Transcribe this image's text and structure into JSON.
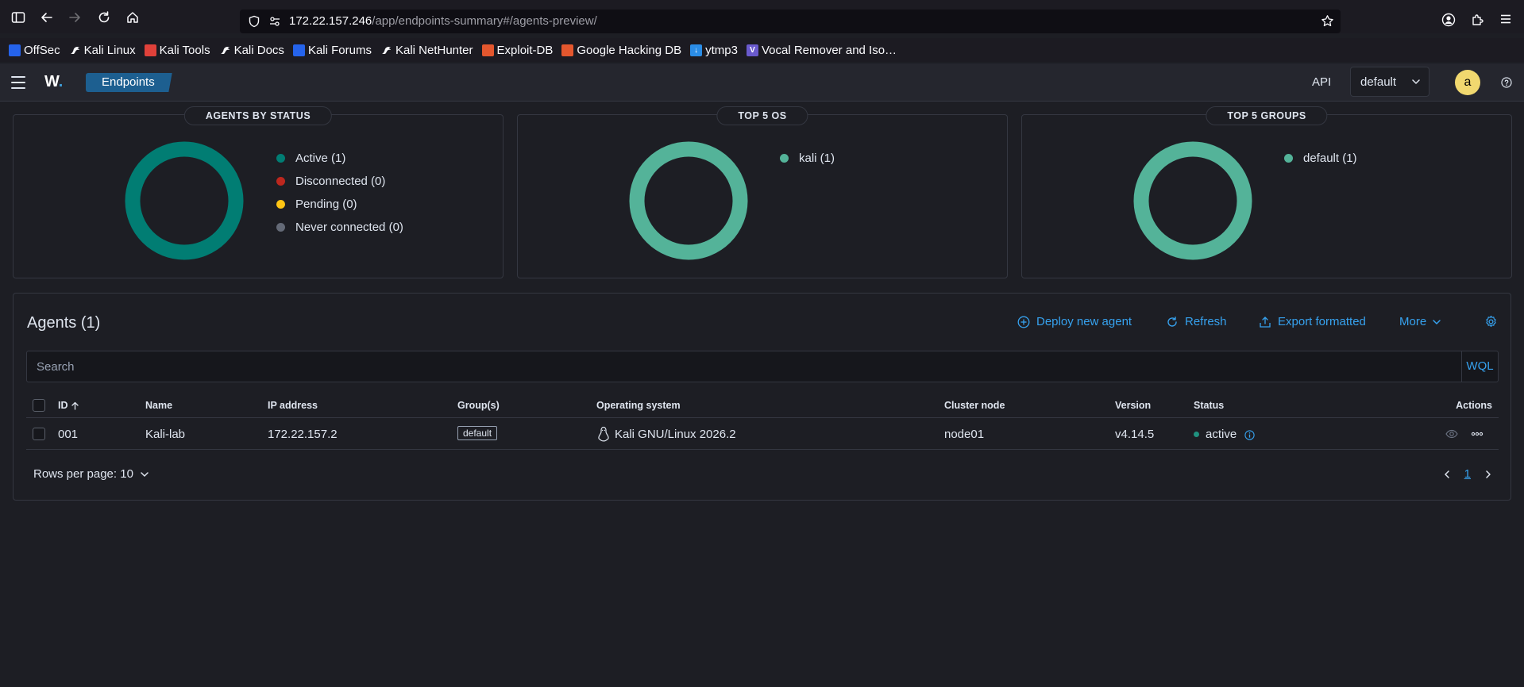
{
  "browser": {
    "url_host": "172.22.157.246",
    "url_path": "/app/endpoints-summary#/agents-preview/",
    "bookmarks": [
      {
        "label": "OffSec",
        "icon": "offsec-icon",
        "color": "#2563eb"
      },
      {
        "label": "Kali Linux",
        "icon": "kali-dragon-icon",
        "color": "#1c1b22"
      },
      {
        "label": "Kali Tools",
        "icon": "kali-tools-icon",
        "color": "#e0413a"
      },
      {
        "label": "Kali Docs",
        "icon": "kali-dragon-icon",
        "color": "#1c1b22"
      },
      {
        "label": "Kali Forums",
        "icon": "kali-forums-icon",
        "color": "#2563eb"
      },
      {
        "label": "Kali NetHunter",
        "icon": "kali-dragon-icon",
        "color": "#1c1b22"
      },
      {
        "label": "Exploit-DB",
        "icon": "exploit-db-icon",
        "color": "#e4572e"
      },
      {
        "label": "Google Hacking DB",
        "icon": "ghdb-icon",
        "color": "#e4572e"
      },
      {
        "label": "ytmp3",
        "icon": "download-icon",
        "color": "#2b8de6"
      },
      {
        "label": "Vocal Remover and Iso…",
        "icon": "vocal-remover-icon",
        "color": "#6a5acd"
      }
    ]
  },
  "header": {
    "logo": "W",
    "breadcrumb": "Endpoints",
    "api_label": "API",
    "tenant": "default",
    "avatar_initial": "a"
  },
  "panels": [
    {
      "title": "AGENTS BY STATUS",
      "ring_color": "#017d73",
      "legend": [
        {
          "label": "Active (1)",
          "color": "#017d73"
        },
        {
          "label": "Disconnected (0)",
          "color": "#bd271e"
        },
        {
          "label": "Pending (0)",
          "color": "#fec514"
        },
        {
          "label": "Never connected (0)",
          "color": "#646a77"
        }
      ]
    },
    {
      "title": "TOP 5 OS",
      "ring_color": "#54b399",
      "legend": [
        {
          "label": "kali (1)",
          "color": "#54b399"
        }
      ]
    },
    {
      "title": "TOP 5 GROUPS",
      "ring_color": "#54b399",
      "legend": [
        {
          "label": "default (1)",
          "color": "#54b399"
        }
      ]
    }
  ],
  "agents": {
    "title": "Agents (1)",
    "actions": {
      "deploy": "Deploy new agent",
      "refresh": "Refresh",
      "export": "Export formatted",
      "more": "More"
    },
    "search_placeholder": "Search",
    "wql": "WQL",
    "columns": {
      "id": "ID",
      "name": "Name",
      "ip": "IP address",
      "groups": "Group(s)",
      "os": "Operating system",
      "cluster": "Cluster node",
      "version": "Version",
      "status": "Status",
      "actions": "Actions"
    },
    "rows": [
      {
        "id": "001",
        "name": "Kali-lab",
        "ip": "172.22.157.2",
        "group": "default",
        "os": "Kali GNU/Linux 2026.2",
        "cluster": "node01",
        "version": "v4.14.5",
        "status": "active"
      }
    ],
    "rows_per_page": "Rows per page: 10",
    "current_page": "1"
  }
}
